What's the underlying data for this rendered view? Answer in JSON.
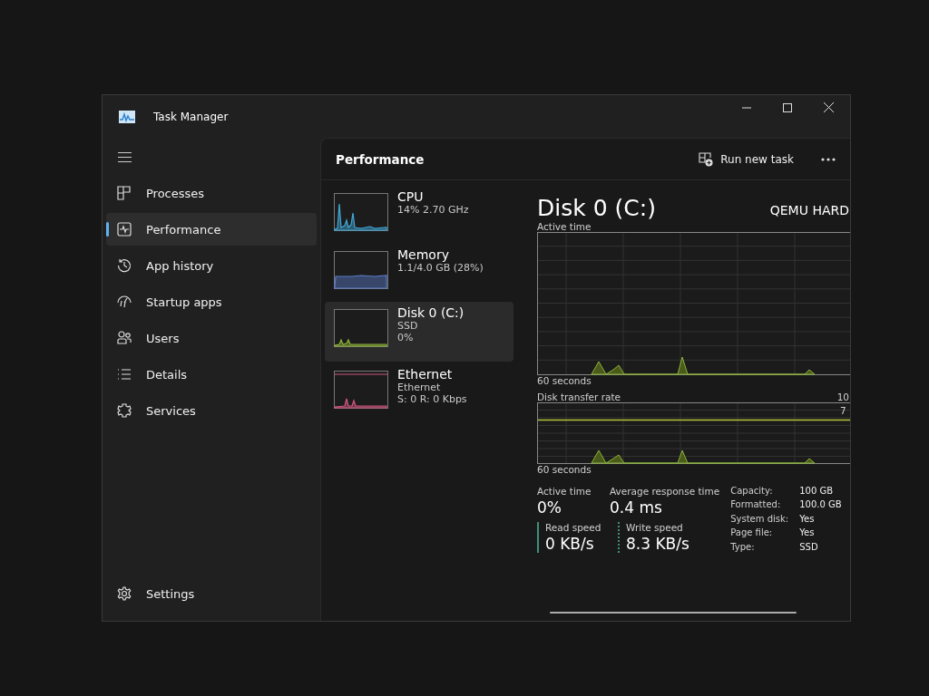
{
  "window": {
    "title": "Task Manager"
  },
  "sidebar": {
    "items": [
      {
        "label": "Processes",
        "selected": false
      },
      {
        "label": "Performance",
        "selected": true
      },
      {
        "label": "App history",
        "selected": false
      },
      {
        "label": "Startup apps",
        "selected": false
      },
      {
        "label": "Users",
        "selected": false
      },
      {
        "label": "Details",
        "selected": false
      },
      {
        "label": "Services",
        "selected": false
      }
    ],
    "settings": "Settings"
  },
  "header": {
    "title": "Performance",
    "run_task": "Run new task"
  },
  "devices": [
    {
      "name": "CPU",
      "lines": [
        "14% 2.70 GHz"
      ],
      "kind": "cpu",
      "color": "#41a8d8",
      "selected": false
    },
    {
      "name": "Memory",
      "lines": [
        "1.1/4.0 GB (28%)"
      ],
      "kind": "memory",
      "color": "#5a7cc8",
      "selected": false
    },
    {
      "name": "Disk 0 (C:)",
      "lines": [
        "SSD",
        "0%"
      ],
      "kind": "disk",
      "color": "#8db33a",
      "selected": true
    },
    {
      "name": "Ethernet",
      "lines": [
        "Ethernet",
        "S: 0 R: 0 Kbps"
      ],
      "kind": "network",
      "color": "#d0577e",
      "selected": false
    }
  ],
  "detail": {
    "title": "Disk 0 (C:)",
    "model": "QEMU HARD",
    "active_chart": {
      "label": "Active time",
      "footer": "60 seconds"
    },
    "transfer_chart": {
      "label": "Disk transfer rate",
      "max": "10",
      "mid": "7",
      "footer": "60 seconds"
    },
    "stats": [
      {
        "label": "Active time",
        "value": "0%"
      },
      {
        "label": "Average response time",
        "value": "0.4 ms"
      }
    ],
    "speeds": [
      {
        "label": "Read speed",
        "value": "0 KB/s",
        "kind": "solid"
      },
      {
        "label": "Write speed",
        "value": "8.3 KB/s",
        "kind": "dashed"
      }
    ],
    "properties": [
      {
        "label": "Capacity:",
        "value": "100 GB"
      },
      {
        "label": "Formatted:",
        "value": "100.0 GB"
      },
      {
        "label": "System disk:",
        "value": "Yes"
      },
      {
        "label": "Page file:",
        "value": "Yes"
      },
      {
        "label": "Type:",
        "value": "SSD"
      }
    ]
  }
}
